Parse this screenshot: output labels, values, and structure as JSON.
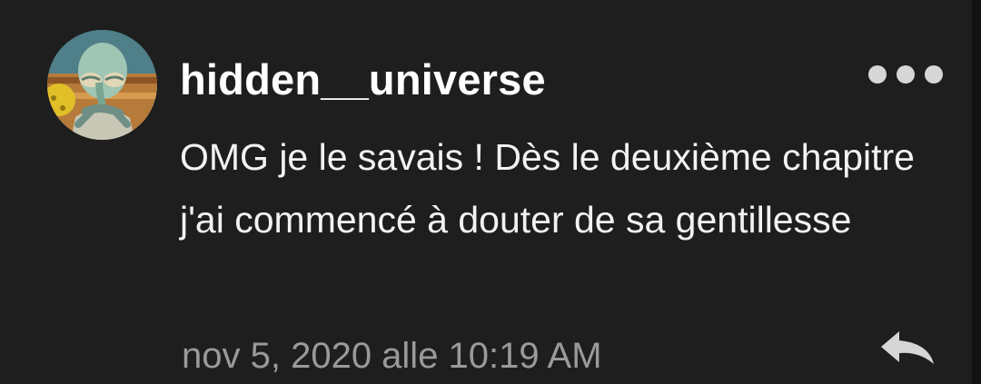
{
  "comment": {
    "username": "hidden__universe",
    "text": "OMG je le savais ! Dès le deuxième chapitre j'ai commencé à douter de sa gentillesse",
    "timestamp": "nov 5, 2020 alle 10:19 AM"
  },
  "icons": {
    "avatar": "user-avatar",
    "more": "more-options-icon",
    "reply": "reply-icon"
  },
  "colors": {
    "background": "#1e1e1f",
    "username": "#ffffff",
    "text": "#f2f2f2",
    "timestamp": "#9a9a9a",
    "icon": "#d6d6d6"
  }
}
